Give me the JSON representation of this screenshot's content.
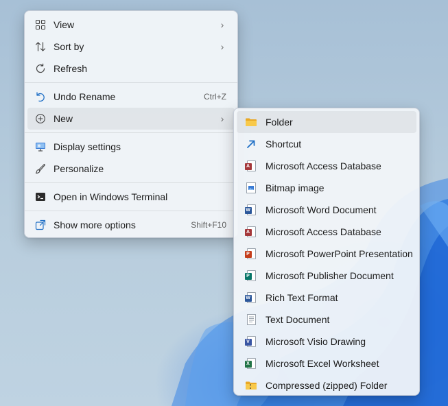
{
  "main_menu": {
    "items": [
      {
        "label": "View",
        "icon": "grid-view-icon",
        "has_submenu": true
      },
      {
        "label": "Sort by",
        "icon": "sort-icon",
        "has_submenu": true
      },
      {
        "label": "Refresh",
        "icon": "refresh-icon",
        "has_submenu": false
      },
      {
        "label": "Undo Rename",
        "icon": "undo-icon",
        "shortcut": "Ctrl+Z"
      },
      {
        "label": "New",
        "icon": "new-plus-icon",
        "has_submenu": true
      },
      {
        "label": "Display settings",
        "icon": "display-settings-icon"
      },
      {
        "label": "Personalize",
        "icon": "brush-icon"
      },
      {
        "label": "Open in Windows Terminal",
        "icon": "terminal-icon"
      },
      {
        "label": "Show more options",
        "icon": "more-options-icon",
        "shortcut": "Shift+F10"
      }
    ]
  },
  "new_submenu": {
    "items": [
      {
        "label": "Folder",
        "icon": "folder-icon"
      },
      {
        "label": "Shortcut",
        "icon": "shortcut-icon"
      },
      {
        "label": "Microsoft Access Database",
        "icon": "access-icon"
      },
      {
        "label": "Bitmap image",
        "icon": "bitmap-icon"
      },
      {
        "label": "Microsoft Word Document",
        "icon": "word-icon"
      },
      {
        "label": "Microsoft Access Database",
        "icon": "access-icon"
      },
      {
        "label": "Microsoft PowerPoint Presentation",
        "icon": "powerpoint-icon"
      },
      {
        "label": "Microsoft Publisher Document",
        "icon": "publisher-icon"
      },
      {
        "label": "Rich Text Format",
        "icon": "rich-text-icon"
      },
      {
        "label": "Text Document",
        "icon": "text-document-icon"
      },
      {
        "label": "Microsoft Visio Drawing",
        "icon": "visio-icon"
      },
      {
        "label": "Microsoft Excel Worksheet",
        "icon": "excel-icon"
      },
      {
        "label": "Compressed (zipped) Folder",
        "icon": "zip-folder-icon"
      }
    ]
  },
  "glyphs": {
    "chevron": "›"
  },
  "colors": {
    "word": "#2b579a",
    "access": "#a4373a",
    "powerpoint": "#c43e1c",
    "publisher": "#077568",
    "excel": "#217346",
    "visio": "#3955a3",
    "folder": "#f5c33b",
    "shortcut": "#1f6fc5"
  }
}
